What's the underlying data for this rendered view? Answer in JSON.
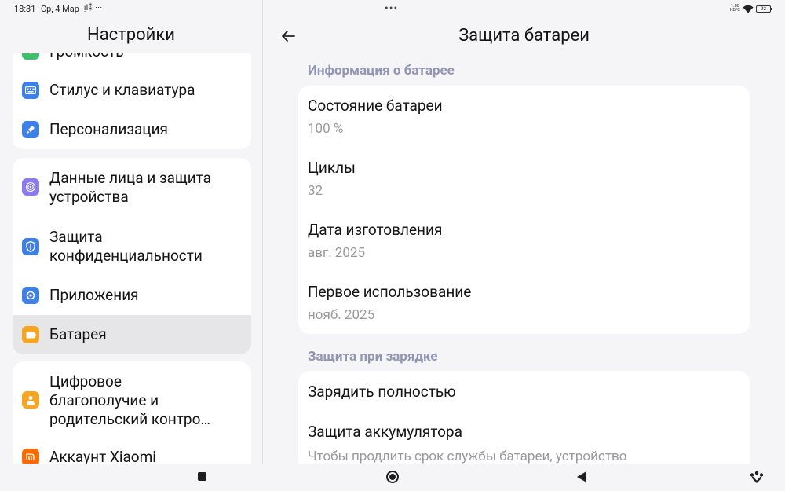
{
  "status_bar": {
    "time": "18:31",
    "date": "Ср, 4 Мар",
    "notif_icons": "ᴉl⁑ ···",
    "dots": "•••",
    "speed_top": "1.88",
    "speed_bottom": "КБ/С",
    "battery": "92"
  },
  "left": {
    "title": "Настройки",
    "card1_items": [
      {
        "label": "Громкость",
        "icon": "volume-icon"
      },
      {
        "label": "Стилус и клавиатура",
        "icon": "keyboard-icon"
      },
      {
        "label": "Персонализация",
        "icon": "brush-icon"
      }
    ],
    "card2_items": [
      {
        "label_line1": "Данные лица и защита",
        "label_line2": "устройства",
        "icon": "fingerprint-icon"
      },
      {
        "label_line1": "Защита",
        "label_line2": "конфиденциальности",
        "icon": "privacy-shield-icon"
      },
      {
        "label": "Приложения",
        "icon": "apps-gear-icon"
      },
      {
        "label": "Батарея",
        "icon": "battery-icon",
        "selected": true
      }
    ],
    "card3_items": [
      {
        "label_line1": "Цифровое",
        "label_line2": "благополучие и",
        "label_line3": "родительский контро…",
        "icon": "wellbeing-icon"
      },
      {
        "label": "Аккаунт Xiaomi",
        "icon": "xiaomi-icon"
      }
    ]
  },
  "right": {
    "title": "Защита батареи",
    "section1": "Информация о батарее",
    "info": [
      {
        "label": "Состояние батареи",
        "value": "100 %"
      },
      {
        "label": "Циклы",
        "value": "32"
      },
      {
        "label": "Дата изготовления",
        "value": "авг. 2025"
      },
      {
        "label": "Первое использование",
        "value": "нояб. 2025"
      }
    ],
    "section2": "Защита при зарядке",
    "charge_items": [
      {
        "label": "Зарядить полностью"
      },
      {
        "label": "Защита аккумулятора",
        "desc": "Чтобы продлить срок службы батареи, устройство"
      }
    ]
  },
  "colors": {
    "accent_section": "#9296b4",
    "icon_blue": "#3f7fe8",
    "icon_green": "#3fbf6b",
    "icon_purple": "#8a7cf0",
    "icon_orange": "#f5a524",
    "icon_xiaomi": "#ff6a00"
  }
}
